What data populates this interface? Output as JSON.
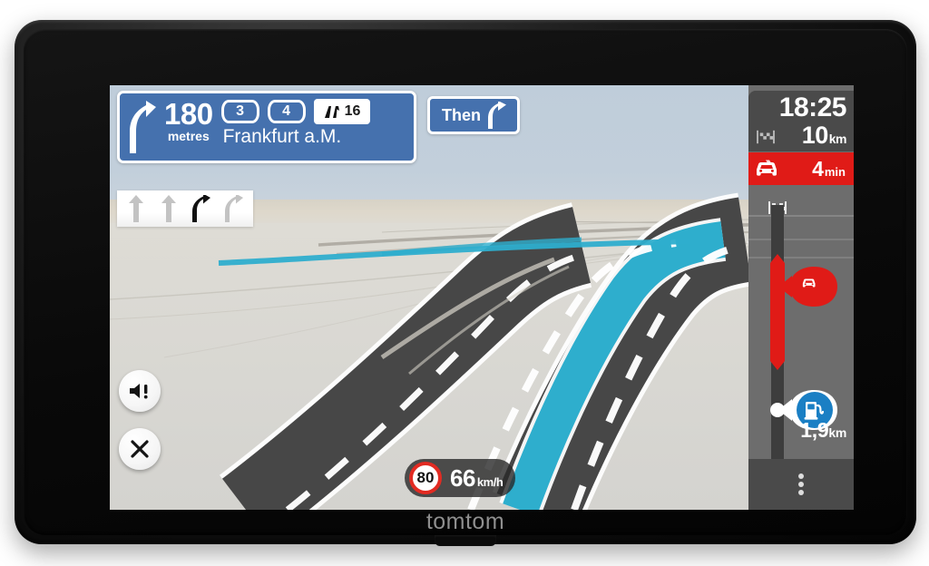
{
  "device": {
    "brand": "tomtom"
  },
  "instruction": {
    "distance_value": "180",
    "distance_unit": "metres",
    "maneuver_icon": "turn-slight-right-arrow",
    "exit_shields": [
      "3",
      "4"
    ],
    "road_shield": {
      "icon": "autobahn-shield-icon",
      "number": "16"
    },
    "destination": "Frankfurt a.M."
  },
  "then": {
    "label": "Then",
    "icon": "turn-slight-right-arrow"
  },
  "lanes": [
    {
      "direction": "straight",
      "active": false
    },
    {
      "direction": "straight",
      "active": false
    },
    {
      "direction": "slight-right",
      "active": true
    },
    {
      "direction": "slight-right",
      "active": false
    }
  ],
  "route_bar": {
    "arrival_time": "18:25",
    "remaining_distance": "10",
    "remaining_distance_unit": "km",
    "destination_icon": "checkered-flag-icon",
    "delay": {
      "icon": "traffic-car-icon",
      "value": "4",
      "unit": "min",
      "color": "#e01b17"
    },
    "events": [
      {
        "type": "traffic-jam",
        "icon": "traffic-car-icon",
        "color": "#e01b17"
      },
      {
        "type": "fuel-station",
        "icon": "fuel-pump-icon",
        "color": "#1a7fc4"
      }
    ],
    "current_position_icon": "position-arrow-icon",
    "distance_to_next": "1,9",
    "distance_to_next_unit": "km",
    "menu_icon": "kebab-menu-icon"
  },
  "controls": {
    "sound_alert_icon": "speaker-alert-icon",
    "close_icon": "close-icon"
  },
  "speed": {
    "limit": "80",
    "current": "66",
    "unit": "km/h"
  },
  "colors": {
    "sign_blue": "#4571ae",
    "route_cyan": "#2eaecd",
    "traffic_red": "#e01b17",
    "poi_blue": "#1a7fc4",
    "road_grey": "#474747"
  }
}
